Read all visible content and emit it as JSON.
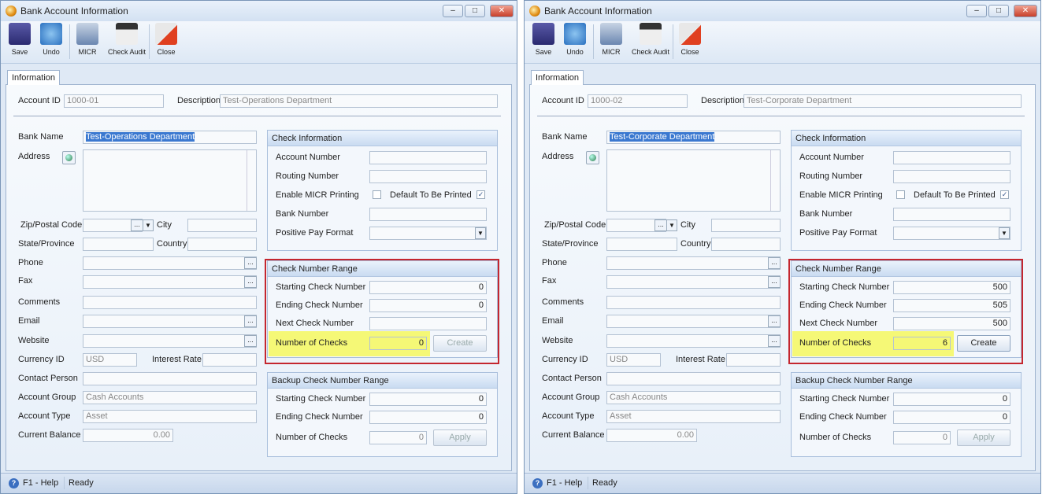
{
  "colors": {
    "highlight": "#f6f84a",
    "red_frame": "#c4262e"
  },
  "toolbar": [
    {
      "label": "Save",
      "icon": "save-icon"
    },
    {
      "label": "Undo",
      "icon": "undo-icon"
    },
    {
      "label": "MICR",
      "icon": "micr-icon"
    },
    {
      "label": "Check Audit",
      "icon": "check-audit-icon"
    },
    {
      "label": "Close",
      "icon": "close-icon"
    }
  ],
  "labels": {
    "tab": "Information",
    "account_id": "Account ID",
    "description": "Description",
    "bank_name": "Bank Name",
    "address": "Address",
    "zip": "Zip/Postal Code",
    "city": "City",
    "state": "State/Province",
    "country": "Country",
    "phone": "Phone",
    "fax": "Fax",
    "comments": "Comments",
    "email": "Email",
    "website": "Website",
    "currency_id": "Currency ID",
    "interest_rate": "Interest Rate",
    "contact_person": "Contact Person",
    "account_group": "Account Group",
    "account_type": "Account Type",
    "current_balance": "Current Balance",
    "check_info": "Check Information",
    "account_number": "Account Number",
    "routing_number": "Routing Number",
    "enable_micr": "Enable MICR Printing",
    "default_printed": "Default To Be Printed",
    "bank_number": "Bank Number",
    "positive_pay": "Positive Pay Format",
    "check_range": "Check Number Range",
    "starting": "Starting Check Number",
    "ending": "Ending Check Number",
    "next": "Next Check Number",
    "num_checks": "Number of Checks",
    "create": "Create",
    "backup_range": "Backup Check Number Range",
    "apply": "Apply",
    "help": "F1 - Help",
    "status": "Ready",
    "help_glyph": "?"
  },
  "windows": [
    {
      "title": "Bank Account Information",
      "account_id": "1000-01",
      "description": "Test-Operations Department",
      "bank_name": "Test-Operations Department",
      "currency_id": "USD",
      "account_group": "Cash Accounts",
      "account_type": "Asset",
      "current_balance": "0.00",
      "enable_micr": false,
      "default_printed": true,
      "range": {
        "starting": "0",
        "ending": "0",
        "next": "",
        "num_checks": "0",
        "create_enabled": false
      },
      "backup": {
        "starting": "0",
        "ending": "0",
        "num_checks": "0"
      }
    },
    {
      "title": "Bank Account Information",
      "account_id": "1000-02",
      "description": "Test-Corporate Department",
      "bank_name": "Test-Corporate Department",
      "currency_id": "USD",
      "account_group": "Cash Accounts",
      "account_type": "Asset",
      "current_balance": "0.00",
      "enable_micr": false,
      "default_printed": true,
      "range": {
        "starting": "500",
        "ending": "505",
        "next": "500",
        "num_checks": "6",
        "create_enabled": true
      },
      "backup": {
        "starting": "0",
        "ending": "0",
        "num_checks": "0"
      }
    }
  ]
}
